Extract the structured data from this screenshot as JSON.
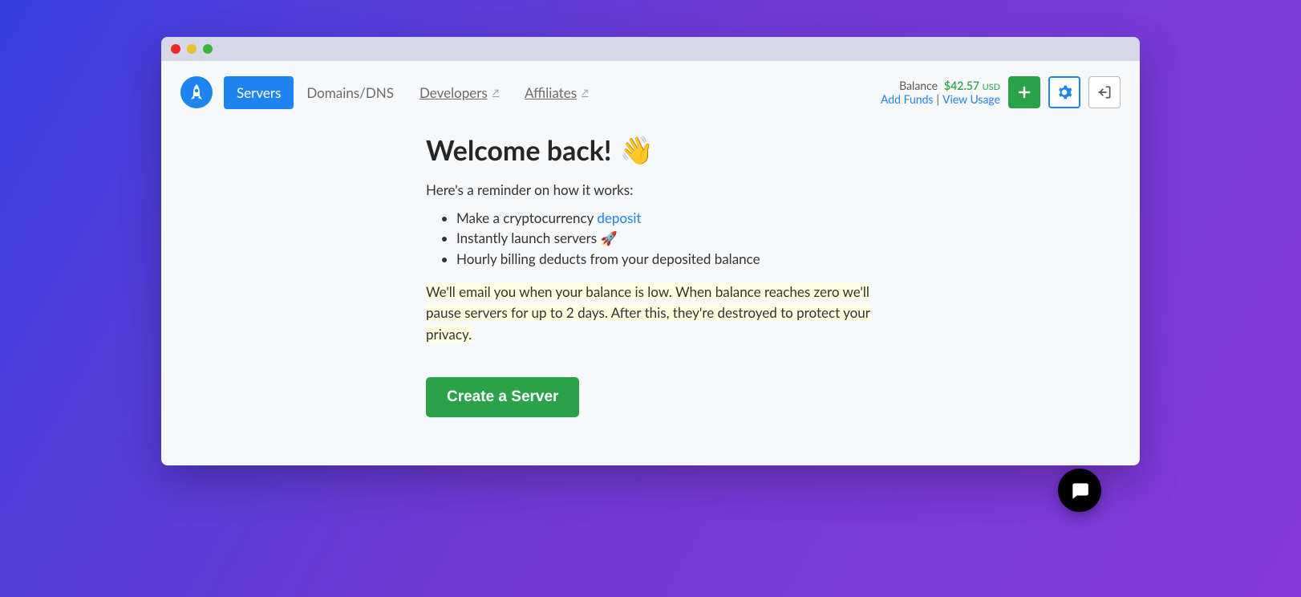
{
  "nav": {
    "servers": "Servers",
    "domains": "Domains/DNS",
    "developers": "Developers",
    "affiliates": "Affiliates"
  },
  "balance": {
    "label": "Balance",
    "amount": "$42.57",
    "currency": "USD",
    "add_funds": "Add Funds",
    "separator": "|",
    "view_usage": "View Usage"
  },
  "welcome": {
    "headline_text": "Welcome back!",
    "wave_emoji": "👋",
    "subtitle": "Here's a reminder on how it works:",
    "list": {
      "item1_pre": "Make a cryptocurrency ",
      "item1_link": "deposit",
      "item2_pre": "Instantly launch servers ",
      "item2_emoji": "🚀",
      "item3": "Hourly billing deducts from your deposited balance"
    },
    "warning": " We'll email you when your balance is low. When balance reaches zero we'll pause servers for up to 2 days. After this, they're destroyed to protect your privacy.",
    "create_button": "Create a Server"
  }
}
